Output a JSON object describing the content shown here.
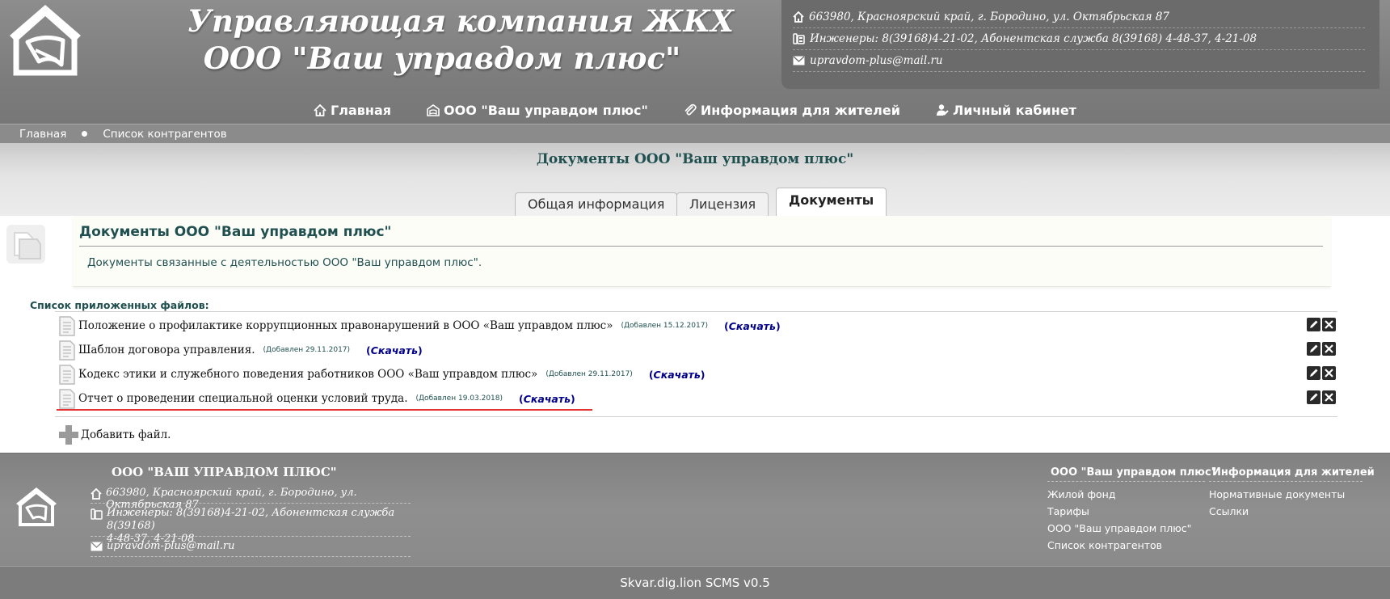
{
  "header": {
    "title_line1": "Управляющая компания ЖКХ",
    "title_line2": "ООО \"Ваш управдом плюс\"",
    "contacts": {
      "address": "663980, Красноярский край, г. Бородино, ул. Октябрьская 87",
      "phones": "Инженеры: 8(39168)4-21-02, Абонентская служба  8(39168) 4-48-37, 4-21-08",
      "email": "upravdom-plus@mail.ru"
    }
  },
  "nav": {
    "items": [
      {
        "label": "Главная",
        "icon": "home-icon"
      },
      {
        "label": "ООО \"Ваш управдом плюс\"",
        "icon": "building-icon"
      },
      {
        "label": "Информация для жителей",
        "icon": "paperclip-icon"
      },
      {
        "label": "Личный кабинет",
        "icon": "user-icon"
      }
    ]
  },
  "breadcrumb": {
    "home": "Главная",
    "current": "Список контрагентов"
  },
  "page": {
    "heading": "Документы ООО \"Ваш управдом плюс\""
  },
  "tabs": [
    {
      "label": "Общая информация",
      "active": false
    },
    {
      "label": "Лицензия",
      "active": false
    },
    {
      "label": "Документы",
      "active": true
    }
  ],
  "info": {
    "title": "Документы ООО \"Ваш управдом плюс\"",
    "description": "Документы связанные с деятельностью ООО \"Ваш управдом плюс\"."
  },
  "files": {
    "heading": "Список приложенных файлов:",
    "download_label": "Скачать",
    "items": [
      {
        "name": "Положение о профилактике коррупционных правонарушений в ООО «Ваш управдом плюс»",
        "added": "(Добавлен 15.12.2017)"
      },
      {
        "name": "Шаблон договора управления.",
        "added": "(Добавлен 29.11.2017)"
      },
      {
        "name": "Кодекс этики и служебного поведения работников ООО «Ваш управдом плюс»",
        "added": "(Добавлен 29.11.2017)"
      },
      {
        "name": "Отчет о проведении специальной оценки условий труда.",
        "added": "(Добавлен 19.03.2018)"
      }
    ],
    "add_label": "Добавить файл."
  },
  "footer": {
    "org": "ООО \"ВАШ УПРАВДОМ ПЛЮС\"",
    "address": "663980, Красноярский край, г. Бородино, ул. Октябрьская 87",
    "phones_line1": "Инженеры: 8(39168)4-21-02, Абонентская служба  8(39168)",
    "phones_line2": "4-48-37, 4-21-08",
    "email": "upravdom-plus@mail.ru",
    "menu1": {
      "head": "ООО \"Ваш управдом плюс\"",
      "links": [
        "Жилой фонд",
        "Тарифы",
        "ООО \"Ваш управдом плюс\"",
        "Список контрагентов"
      ]
    },
    "menu2": {
      "head": "Информация для жителей",
      "links": [
        "Нормативные документы",
        "Ссылки"
      ]
    },
    "bottom": "Skvar.dig.lion SCMS v0.5"
  },
  "colors": {
    "header_gray": "#8d8d8d",
    "accent_teal": "#1f4f4f",
    "download_blue": "#00008b",
    "highlight_red": "#e53232"
  }
}
